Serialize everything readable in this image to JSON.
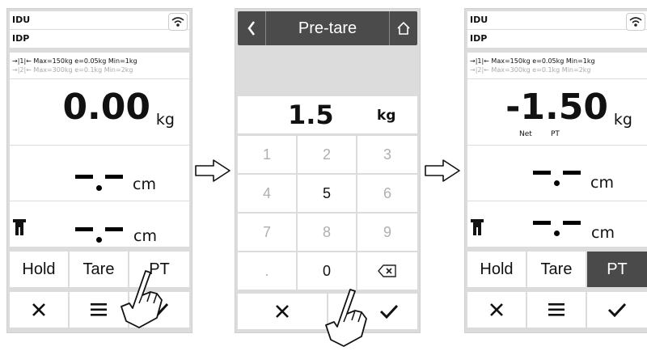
{
  "screen1": {
    "line1": "IDU",
    "line2": "IDP",
    "range1": "→|1|← Max=150kg e=0.05kg Min=1kg",
    "range2": "→|2|← Max=300kg e=0.1kg Min=2kg",
    "weight": "0.00",
    "weight_unit": "kg",
    "length_unit": "cm",
    "height_unit": "cm",
    "buttons": [
      "Hold",
      "Tare",
      "PT"
    ]
  },
  "screen2": {
    "title": "Pre-tare",
    "entry_value": "1.5",
    "entry_unit": "kg",
    "keys": [
      "1",
      "2",
      "3",
      "4",
      "5",
      "6",
      "7",
      "8",
      "9",
      ".",
      "0"
    ],
    "disabled_keys": [
      "1",
      "2",
      "3",
      "4",
      "6",
      "7",
      "8",
      "9",
      "."
    ]
  },
  "screen3": {
    "line1": "IDU",
    "line2": "IDP",
    "range1": "→|1|← Max=150kg e=0.05kg Min=1kg",
    "range2": "→|2|← Max=300kg e=0.1kg Min=2kg",
    "weight": "-1.50",
    "weight_unit": "kg",
    "net_label": "Net",
    "pt_label": "PT",
    "length_unit": "cm",
    "height_unit": "cm",
    "buttons": [
      "Hold",
      "Tare",
      "PT"
    ],
    "active_button": "PT"
  },
  "icons": [
    "wifi-icon",
    "back-icon",
    "home-icon",
    "close-icon",
    "menu-icon",
    "check-icon",
    "backspace-icon",
    "height-rod-icon",
    "right-arrow-icon",
    "hand-pointer-icon"
  ],
  "colors": {
    "active_button_bg": "#4a4a4a",
    "titlebar_bg": "#4b4b4b",
    "frame_bg": "#dcdcdc",
    "disabled_key": "#b0b0b0"
  }
}
